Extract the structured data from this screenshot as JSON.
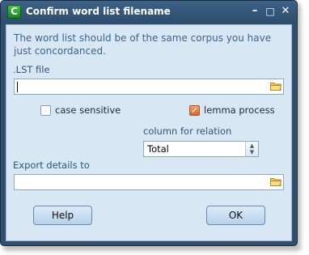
{
  "window": {
    "title": "Confirm word list filename",
    "app_icon_letter": "C",
    "minimize_glyph": "–",
    "maximize_glyph": "□",
    "close_glyph": "✕"
  },
  "form": {
    "info_text": "The word list should be of the same corpus you have just concordanced.",
    "lst_label": ".LST file",
    "lst_value": "",
    "case_sensitive_label": "case sensitive",
    "case_sensitive_checked": false,
    "lemma_label": "lemma process",
    "lemma_checked": true,
    "column_label": "column for relation",
    "column_value": "Total",
    "export_label": "Export details to",
    "export_value": ""
  },
  "buttons": {
    "help": "Help",
    "ok": "OK"
  },
  "colors": {
    "frame": "#2f4f6e",
    "client": "#d7e7f4",
    "label": "#31557a",
    "check_on": "#d8672e"
  },
  "icons": [
    "folder-icon",
    "minimize-icon",
    "maximize-icon",
    "close-icon",
    "spinner-icon"
  ]
}
